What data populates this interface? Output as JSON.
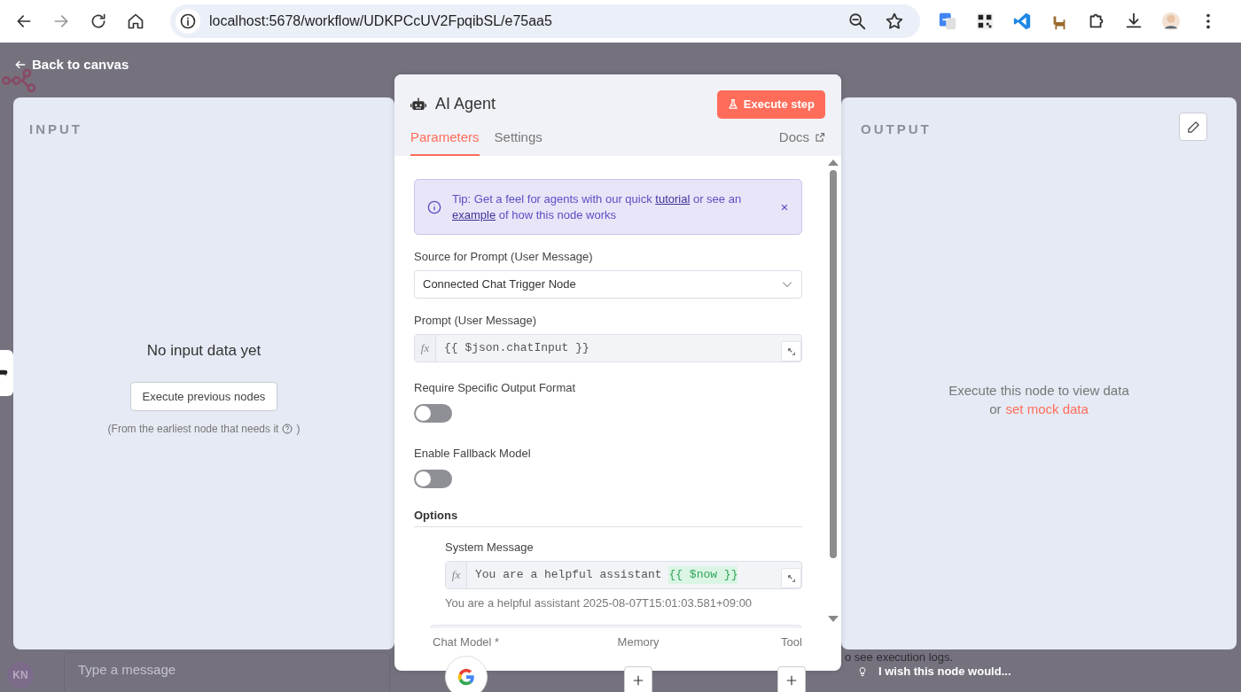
{
  "browser": {
    "address": "localhost:5678/workflow/UDKPCcUV2FpqibSL/e75aa5"
  },
  "canvas": {
    "back_link": "Back to canvas",
    "chat_placeholder": "Type a message",
    "avatar": "KN",
    "log_text": "o see execution logs.",
    "feedback": "I wish this node would..."
  },
  "input_panel": {
    "title": "INPUT",
    "heading": "No input data yet",
    "button": "Execute previous nodes",
    "hint": "(From the earliest node that needs it",
    "hint_end": ")"
  },
  "node": {
    "title": "AI Agent",
    "execute_button": "Execute step",
    "tabs": [
      {
        "label": "Parameters",
        "selected": true
      },
      {
        "label": "Settings",
        "selected": false
      }
    ],
    "docs_link": "Docs",
    "tip": [
      {
        "text": "Tip: Get a feel for agents with our quick "
      },
      {
        "text": "tutorial",
        "link": true
      },
      {
        "text": " or see an "
      },
      {
        "text": "example",
        "link": true
      },
      {
        "text": " of how this node works"
      }
    ],
    "fields": [
      {
        "kind": "select",
        "label": "Source for Prompt (User Message)",
        "value": "Connected Chat Trigger Node"
      },
      {
        "kind": "expression",
        "label": "Prompt (User Message)",
        "prefix": "fx",
        "parts": [
          {
            "text": "{{ $json.chatInput }}",
            "highlight": false
          }
        ]
      },
      {
        "kind": "toggle",
        "label": "Require Specific Output Format",
        "on": false
      },
      {
        "kind": "toggle",
        "label": "Enable Fallback Model",
        "on": false
      }
    ],
    "options": {
      "title": "Options",
      "fields": [
        {
          "kind": "expression",
          "label": "System Message",
          "prefix": "fx",
          "parts": [
            {
              "text": "You are a helpful assistant ",
              "highlight": false
            },
            {
              "text": "{{ $now }}",
              "highlight": true
            }
          ],
          "preview": "You are a helpful assistant 2025-08-07T15:01:03.581+09:00"
        }
      ]
    },
    "connectors": [
      {
        "label": "Chat Model *",
        "kind": "model"
      },
      {
        "label": "Memory",
        "kind": "add"
      },
      {
        "label": "Tool",
        "kind": "add"
      }
    ]
  },
  "output_panel": {
    "title": "OUTPUT",
    "message": "Execute this node to view data",
    "or": "or",
    "link": "set mock data"
  }
}
